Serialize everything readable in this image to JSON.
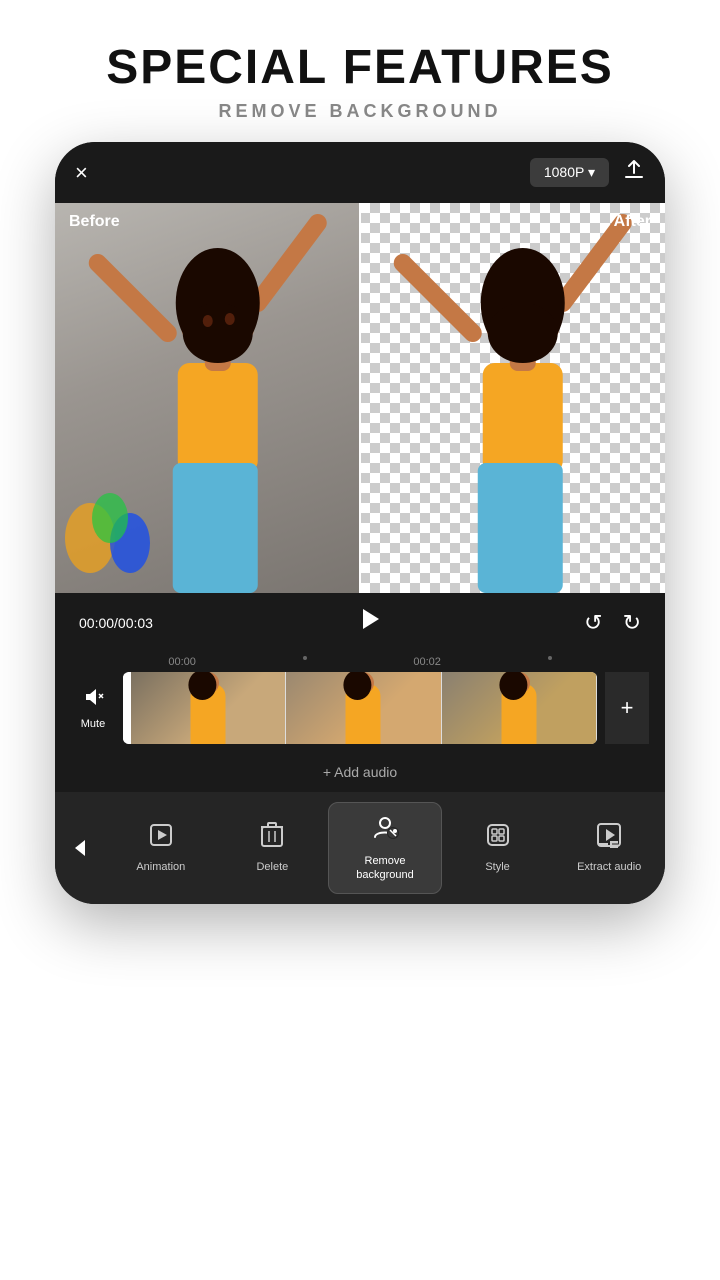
{
  "header": {
    "title": "SPECIAL FEATURES",
    "subtitle": "REMOVE BACKGROUND"
  },
  "topbar": {
    "quality": "1080P ▾",
    "close_icon": "×",
    "upload_icon": "↑"
  },
  "preview": {
    "before_label": "Before",
    "after_label": "After"
  },
  "controls": {
    "time_current": "00:00",
    "time_total": "00:03",
    "time_display": "00:00/00:03"
  },
  "timeline": {
    "time_start": "00:00",
    "time_mid": "00:02"
  },
  "mute": {
    "label": "Mute"
  },
  "add_audio": {
    "label": "+ Add audio"
  },
  "toolbar": {
    "back_icon": "‹",
    "items": [
      {
        "id": "animation",
        "label": "Animation",
        "icon": "▶"
      },
      {
        "id": "delete",
        "label": "Delete",
        "icon": "🗑"
      },
      {
        "id": "remove-bg",
        "label": "Remove\nbackground",
        "icon": "👤",
        "active": true
      },
      {
        "id": "style",
        "label": "Style",
        "icon": "◈"
      },
      {
        "id": "extract-audio",
        "label": "Extract audio",
        "icon": "▶"
      }
    ]
  }
}
